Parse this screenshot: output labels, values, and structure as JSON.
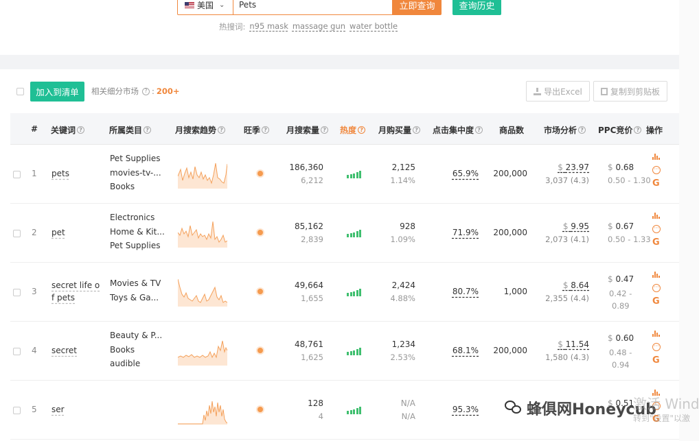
{
  "search": {
    "country": "美国",
    "query": "Pets",
    "query_button": "立即查询",
    "history_button": "查询历史",
    "hot_label": "热搜词:",
    "hot_keywords": [
      "n95 mask",
      "massage gun",
      "water bottle"
    ]
  },
  "toolbar": {
    "add_button": "加入到清单",
    "sub_market_label": "相关细分市场",
    "sub_market_count": "200+",
    "export_button": "导出Excel",
    "copy_button": "复制到剪贴板"
  },
  "columns": [
    "#",
    "关键词",
    "所属类目",
    "月搜索趋势",
    "旺季",
    "月搜索量",
    "热度",
    "月购买量",
    "点击集中度",
    "商品数",
    "市场分析",
    "PPC竞价",
    "操作"
  ],
  "rows": [
    {
      "index": "1",
      "keyword": [
        "pets"
      ],
      "categories": [
        "Pet Supplies",
        "movies-tv-...",
        "Books"
      ],
      "search_volume": "186,360",
      "search_sub": "6,212",
      "purchases": "2,125",
      "purchase_rate": "1.14%",
      "click_concentration": "65.9%",
      "products": "200,000",
      "market_price": "23.97",
      "market_sub": "3,037 (4.3)",
      "ppc": "0.68",
      "ppc_range": [
        "0.50 - 1.30"
      ],
      "heat_level": 5
    },
    {
      "index": "2",
      "keyword": [
        "pet"
      ],
      "categories": [
        "Electronics",
        "Home & Kit...",
        "Pet Supplies"
      ],
      "search_volume": "85,162",
      "search_sub": "2,839",
      "purchases": "928",
      "purchase_rate": "1.09%",
      "click_concentration": "71.9%",
      "products": "200,000",
      "market_price": "9.95",
      "market_sub": "2,073 (4.1)",
      "ppc": "0.67",
      "ppc_range": [
        "0.50 - 1.33"
      ],
      "heat_level": 5
    },
    {
      "index": "3",
      "keyword": [
        "secret life o",
        "f pets"
      ],
      "categories": [
        "Movies & TV",
        "Toys & Ga..."
      ],
      "search_volume": "49,664",
      "search_sub": "1,655",
      "purchases": "2,424",
      "purchase_rate": "4.88%",
      "click_concentration": "80.7%",
      "products": "1,000",
      "market_price": "8.64",
      "market_sub": "2,355 (4.4)",
      "ppc": "0.47",
      "ppc_range": [
        "0.42 -",
        "0.89"
      ],
      "heat_level": 5
    },
    {
      "index": "4",
      "keyword": [
        "secret"
      ],
      "categories": [
        "Beauty & P...",
        "Books",
        "audible"
      ],
      "search_volume": "48,761",
      "search_sub": "1,625",
      "purchases": "1,234",
      "purchase_rate": "2.53%",
      "click_concentration": "68.1%",
      "products": "200,000",
      "market_price": "11.54",
      "market_sub": "1,580 (4.3)",
      "ppc": "0.60",
      "ppc_range": [
        "0.48 -",
        "0.94"
      ],
      "heat_level": 5
    },
    {
      "index": "5",
      "keyword": [
        "ser"
      ],
      "categories": [],
      "search_volume": "128",
      "search_sub": "4",
      "purchases": "N/A",
      "purchase_rate": "N/A",
      "click_concentration": "95.3%",
      "products": "",
      "market_price": "",
      "market_sub": "",
      "ppc": "0.51",
      "ppc_range": [],
      "heat_level": 5
    }
  ],
  "watermarks": {
    "windows_title": "激活 Wind",
    "windows_sub": "转到\"设置\"以激",
    "honeycub": "蜂俱网Honeycub"
  },
  "colors": {
    "accent": "#f0873c",
    "green": "#1fbf95",
    "heat": "#3fbf6f"
  }
}
